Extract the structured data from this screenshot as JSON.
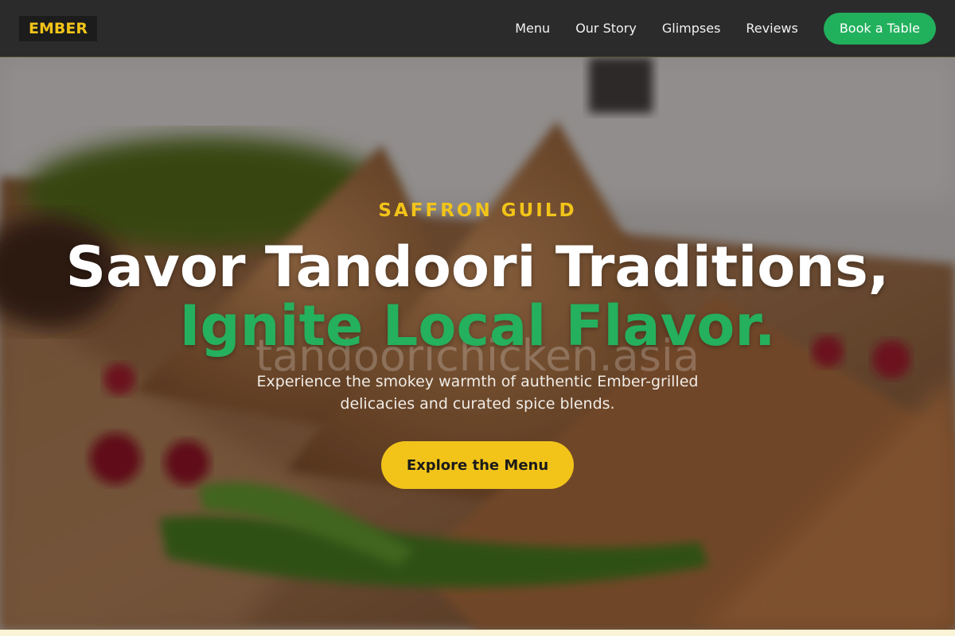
{
  "brand": {
    "logo": "EMBER"
  },
  "nav": {
    "links": [
      {
        "label": "Menu"
      },
      {
        "label": "Our Story"
      },
      {
        "label": "Glimpses"
      },
      {
        "label": "Reviews"
      }
    ],
    "cta": "Book a Table"
  },
  "hero": {
    "eyebrow": "SAFFRON GUILD",
    "title_line1": "Savor Tandoori Traditions,",
    "title_line2": "Ignite Local Flavor.",
    "watermark": "tandoorichicken.asia",
    "subtitle": "Experience the smokey warmth of authentic Ember-grilled delicacies and curated spice blends.",
    "button": "Explore the Menu"
  },
  "colors": {
    "accent_yellow": "#f2c419",
    "accent_green": "#21b05c",
    "nav_bg": "#2b2b2b"
  }
}
